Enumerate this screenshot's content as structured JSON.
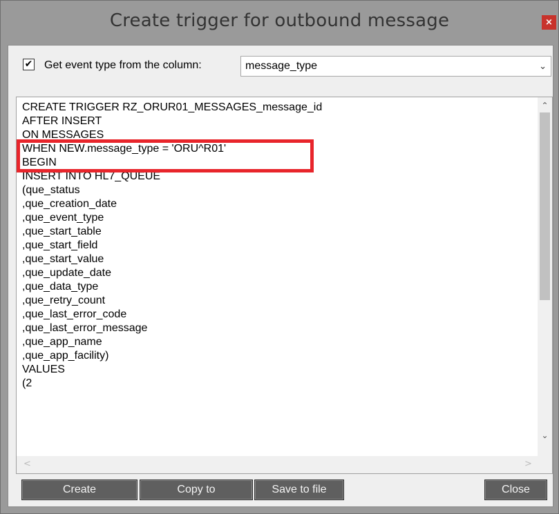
{
  "window": {
    "title": "Create trigger for outbound message",
    "close_glyph": "×"
  },
  "options": {
    "get_event_checked": true,
    "check_glyph": "✔",
    "get_event_label": "Get event type from the column:",
    "column_select": {
      "value": "message_type",
      "arrow": "⌄"
    }
  },
  "code": {
    "lines": [
      "CREATE TRIGGER RZ_ORUR01_MESSAGES_message_id",
      "AFTER INSERT",
      "ON MESSAGES",
      "WHEN NEW.message_type = 'ORU^R01'",
      "BEGIN",
      "INSERT INTO HL7_QUEUE",
      "(que_status",
      ",que_creation_date",
      ",que_event_type",
      ",que_start_table",
      ",que_start_field",
      ",que_start_value",
      ",que_update_date",
      ",que_data_type",
      ",que_retry_count",
      ",que_last_error_code",
      ",que_last_error_message",
      ",que_app_name",
      ",que_app_facility)",
      "VALUES",
      "(2"
    ],
    "highlight_color": "#e8252b"
  },
  "scrollbars": {
    "up_arrow": "⌃",
    "down_arrow": "⌄",
    "left_arrow": "<",
    "right_arrow": ">"
  },
  "buttons": {
    "create": "Create",
    "copy_to": "Copy to",
    "save_to_file": "Save to file",
    "close": "Close"
  }
}
